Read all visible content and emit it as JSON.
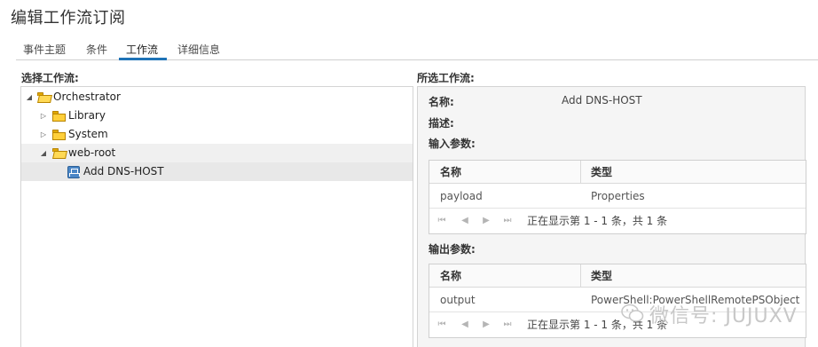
{
  "window": {
    "title": "编辑工作流订阅"
  },
  "tabs": [
    {
      "label": "事件主题"
    },
    {
      "label": "条件"
    },
    {
      "label": "工作流"
    },
    {
      "label": "详细信息"
    }
  ],
  "left": {
    "label": "选择工作流:",
    "tree": [
      {
        "label": "Orchestrator",
        "icon": "folder-open-icon",
        "twisty": "expanded"
      },
      {
        "label": "Library",
        "icon": "folder-icon",
        "twisty": "collapsed"
      },
      {
        "label": "System",
        "icon": "folder-icon",
        "twisty": "collapsed"
      },
      {
        "label": "web-root",
        "icon": "folder-open-icon",
        "twisty": "expanded"
      },
      {
        "label": "Add DNS-HOST",
        "icon": "workflow-icon",
        "selected": true
      }
    ]
  },
  "right": {
    "label": "所选工作流:",
    "name_label": "名称:",
    "name_value": "Add DNS-HOST",
    "desc_label": "描述:",
    "inputs_label": "输入参数:",
    "outputs_label": "输出参数:",
    "inputs": {
      "col_name": "名称",
      "col_type": "类型",
      "rows": [
        {
          "name": "payload",
          "type": "Properties"
        }
      ],
      "pager": "正在显示第 1 - 1 条，共 1 条"
    },
    "outputs": {
      "col_name": "名称",
      "col_type": "类型",
      "rows": [
        {
          "name": "output",
          "type": "PowerShell:PowerShellRemotePSObject"
        }
      ],
      "pager": "正在显示第 1 - 1 条，共 1 条"
    }
  },
  "watermark": {
    "text": "微信号: JUJUXV",
    "icon": "wechat-icon"
  },
  "colors": {
    "accent": "#1f73b7",
    "folder": "#ffcf3a",
    "selected_row": "#e8e8e8",
    "panel_bg": "#f5f5f5"
  }
}
